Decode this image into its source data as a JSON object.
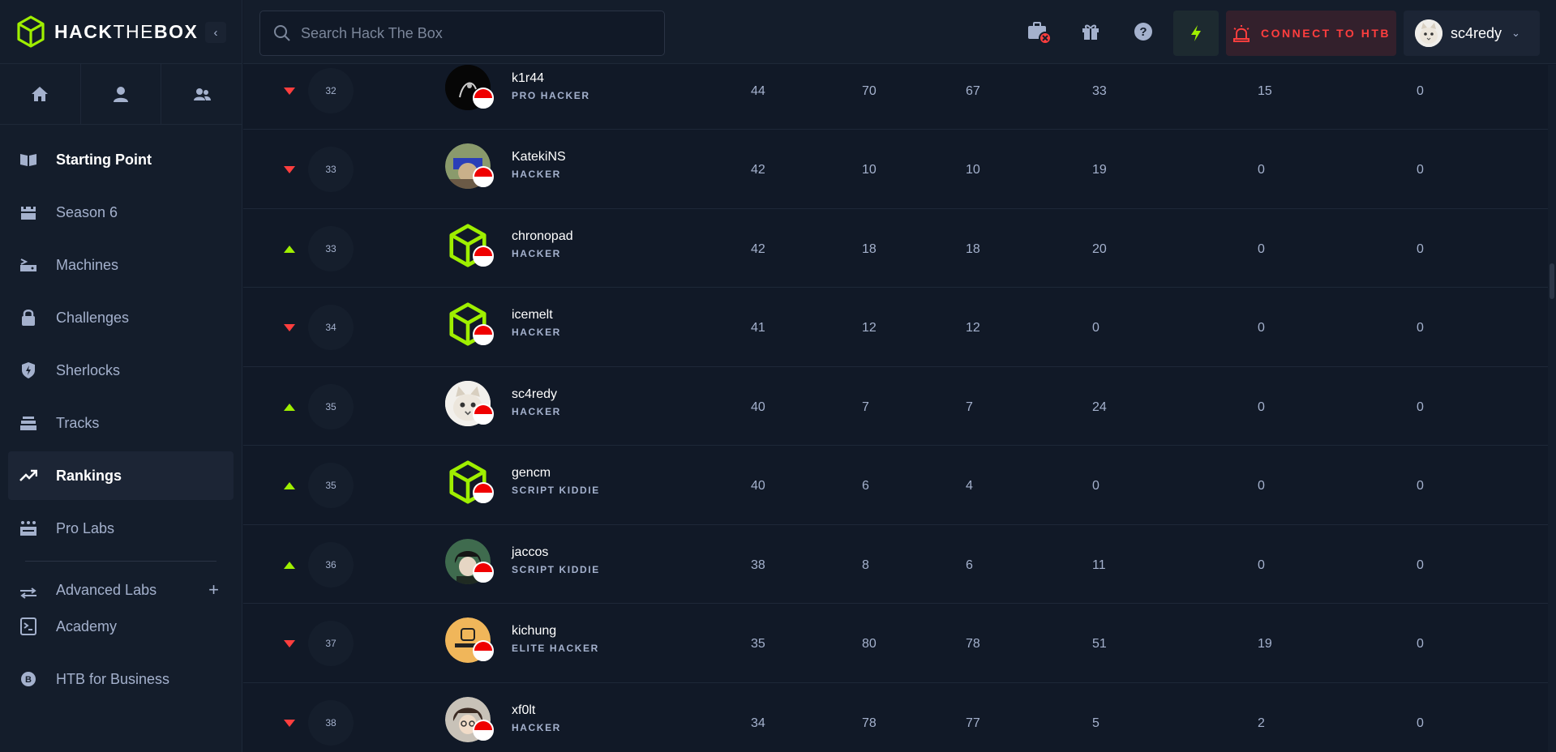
{
  "brand": {
    "name_bold": "HACK",
    "name_light": "THE",
    "name_bold2": "BOX"
  },
  "colors": {
    "accent": "#9fef00",
    "danger": "#ff3e3e",
    "bg": "#111927",
    "panel": "#141d2b"
  },
  "sidebar": {
    "items": [
      {
        "label": "Starting Point",
        "icon": "book-icon"
      },
      {
        "label": "Season 6",
        "icon": "castle-icon"
      },
      {
        "label": "Machines",
        "icon": "server-icon"
      },
      {
        "label": "Challenges",
        "icon": "lock-challenge-icon"
      },
      {
        "label": "Sherlocks",
        "icon": "shield-icon"
      },
      {
        "label": "Tracks",
        "icon": "stack-icon"
      },
      {
        "label": "Rankings",
        "icon": "trending-up-icon"
      },
      {
        "label": "Pro Labs",
        "icon": "labs-icon"
      },
      {
        "label": "Advanced Labs",
        "icon": "arrows-icon"
      },
      {
        "label": "Academy",
        "icon": "terminal-icon"
      },
      {
        "label": "HTB for Business",
        "icon": "business-icon"
      }
    ]
  },
  "topbar": {
    "search_placeholder": "Search Hack The Box",
    "connect_label": "CONNECT TO HTB",
    "username": "sc4redy"
  },
  "rows": [
    {
      "trend": "down",
      "rank": "32",
      "name": "k1r44",
      "rankname": "PRO HACKER",
      "c1": "44",
      "c2": "70",
      "c3": "67",
      "c4": "33",
      "c5": "15",
      "c6": "0"
    },
    {
      "trend": "down",
      "rank": "33",
      "name": "KatekiNS",
      "rankname": "HACKER",
      "c1": "42",
      "c2": "10",
      "c3": "10",
      "c4": "19",
      "c5": "0",
      "c6": "0"
    },
    {
      "trend": "up",
      "rank": "33",
      "name": "chronopad",
      "rankname": "HACKER",
      "c1": "42",
      "c2": "18",
      "c3": "18",
      "c4": "20",
      "c5": "0",
      "c6": "0"
    },
    {
      "trend": "down",
      "rank": "34",
      "name": "icemelt",
      "rankname": "HACKER",
      "c1": "41",
      "c2": "12",
      "c3": "12",
      "c4": "0",
      "c5": "0",
      "c6": "0"
    },
    {
      "trend": "up",
      "rank": "35",
      "name": "sc4redy",
      "rankname": "HACKER",
      "c1": "40",
      "c2": "7",
      "c3": "7",
      "c4": "24",
      "c5": "0",
      "c6": "0"
    },
    {
      "trend": "up",
      "rank": "35",
      "name": "gencm",
      "rankname": "SCRIPT KIDDIE",
      "c1": "40",
      "c2": "6",
      "c3": "4",
      "c4": "0",
      "c5": "0",
      "c6": "0"
    },
    {
      "trend": "up",
      "rank": "36",
      "name": "jaccos",
      "rankname": "SCRIPT KIDDIE",
      "c1": "38",
      "c2": "8",
      "c3": "6",
      "c4": "11",
      "c5": "0",
      "c6": "0"
    },
    {
      "trend": "down",
      "rank": "37",
      "name": "kichung",
      "rankname": "ELITE HACKER",
      "c1": "35",
      "c2": "80",
      "c3": "78",
      "c4": "51",
      "c5": "19",
      "c6": "0"
    },
    {
      "trend": "down",
      "rank": "38",
      "name": "xf0lt",
      "rankname": "HACKER",
      "c1": "34",
      "c2": "78",
      "c3": "77",
      "c4": "5",
      "c5": "2",
      "c6": "0"
    }
  ]
}
